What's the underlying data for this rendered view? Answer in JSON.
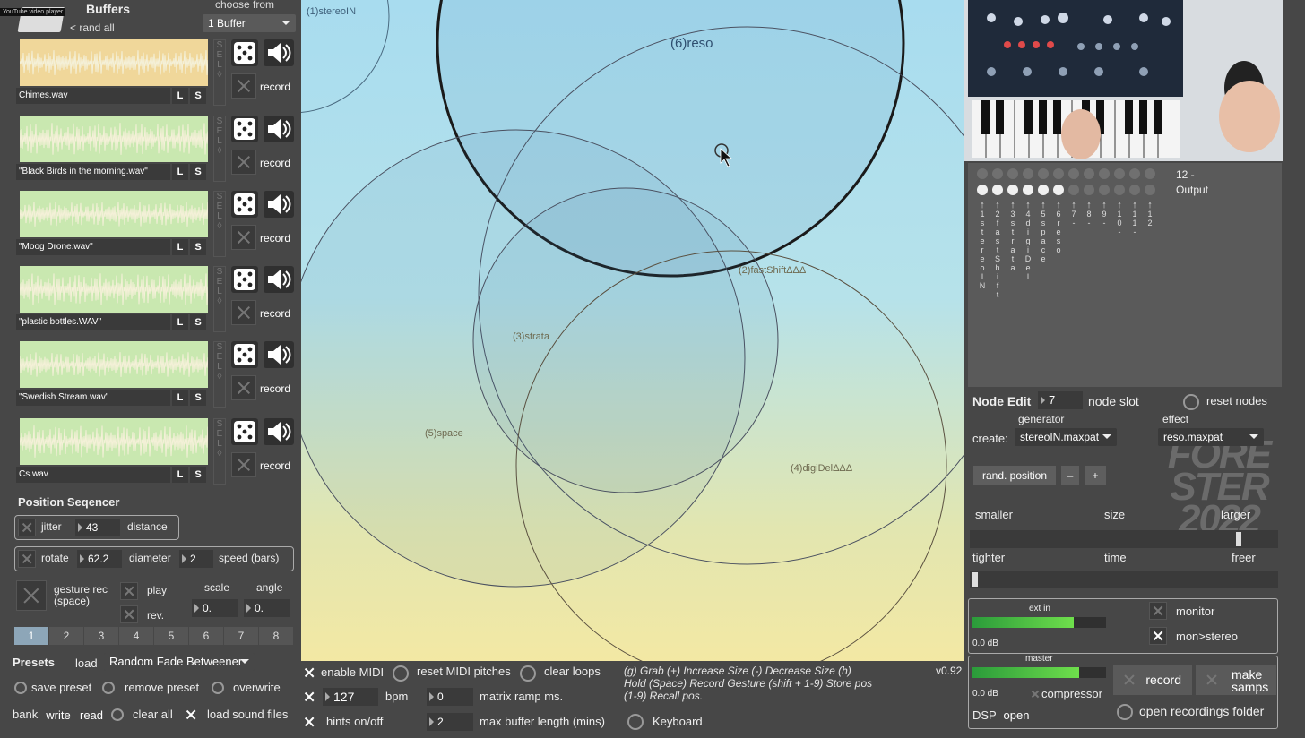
{
  "overlay": {
    "yt_label": "YouTube video player"
  },
  "buffers": {
    "title": "Buffers",
    "rand_all": "< rand all",
    "choose_from": "choose from",
    "choose_value": "1 Buffer",
    "items": [
      {
        "file": "Chimes.wav",
        "wave": "#f0d79a"
      },
      {
        "file": "\"Black Birds in the morning.wav\"",
        "wave": "#c9e8b0"
      },
      {
        "file": "\"Moog Drone.wav\"",
        "wave": "#c9e8b0"
      },
      {
        "file": "\"plastic bottles.WAV\"",
        "wave": "#c9e8b0"
      },
      {
        "file": "\"Swedish Stream.wav\"",
        "wave": "#c9e8b0"
      },
      {
        "file": "Cs.wav",
        "wave": "#c9e8b0"
      }
    ],
    "l": "L",
    "s": "S",
    "record": "record",
    "sel": "SEL"
  },
  "seq": {
    "title": "Position Seqencer",
    "jitter": "jitter",
    "jitter_val": "43",
    "distance": "distance",
    "rotate": "rotate",
    "rotate_val": "62.2",
    "diameter": "diameter",
    "diameter_val": "2",
    "speed": "speed (bars)",
    "gesture": "gesture rec",
    "space": "(space)",
    "play": "play",
    "rev": "rev.",
    "scale": "scale",
    "angle": "angle",
    "scale_val": "0.",
    "angle_val": "0.",
    "steps": [
      "1",
      "2",
      "3",
      "4",
      "5",
      "6",
      "7",
      "8"
    ]
  },
  "presets": {
    "title": "Presets",
    "load": "load",
    "load_value": "Random Fade Betweener",
    "save": "save preset",
    "remove": "remove preset",
    "overwrite": "overwrite",
    "bank": "bank",
    "write": "write",
    "read": "read",
    "clear_all": "clear all",
    "load_sound": "load sound files"
  },
  "canvas": {
    "nodes": [
      "(1)stereoIN",
      "(6)reso",
      "(2)fastShiftΔΔΔ",
      "(3)strata",
      "(5)space",
      "(4)digiDelΔΔΔ"
    ]
  },
  "bottom": {
    "enable_midi": "enable MIDI",
    "reset_midi": "reset MIDI pitches",
    "clear_loops": "clear loops",
    "bpm_val": "127",
    "bpm": "bpm",
    "ramp_val": "0",
    "ramp": "matrix ramp ms.",
    "hints": "hints on/off",
    "maxbuf_val": "2",
    "maxbuf": "max buffer length (mins)",
    "keyboard": "Keyboard",
    "help1": "(g) Grab    (+) Increase Size    (-) Decrease Size    (h)",
    "help2": "Hold   (Space) Record Gesture   (shift + 1-9) Store pos",
    "help3": "(1-9) Recall pos.",
    "version": "v0.92"
  },
  "matrix": {
    "out1": "12 -",
    "out2": "Output",
    "channels": [
      "1 stereoIN",
      "2 fastShift",
      "3 strata",
      "4 digiDel",
      "5 space",
      "6 reso",
      "7 -",
      "8 -",
      "9 -",
      "10 -",
      "11 -",
      "12"
    ],
    "logo": "FORE STER 2022"
  },
  "node_edit": {
    "title": "Node Edit",
    "slot_val": "7",
    "slot": "node slot",
    "reset": "reset nodes",
    "generator": "generator",
    "effect": "effect",
    "create": "create:",
    "gen_value": "stereoIN.maxpat",
    "fx_value": "reso.maxpat",
    "rand_pos": "rand. position",
    "minus": "–",
    "plus": "+",
    "smaller": "smaller",
    "size": "size",
    "larger": "larger",
    "size_level": 0.88,
    "tighter": "tighter",
    "time": "time",
    "freer": "freer",
    "time_level": 0.01
  },
  "audio": {
    "ext_in": "ext in",
    "ext_db": "0.0 dB",
    "ext_level": 0.76,
    "monitor": "monitor",
    "mon_stereo": "mon>stereo",
    "master": "master",
    "master_db": "0.0 dB",
    "master_level": 0.8,
    "compressor": "compressor",
    "record": "record",
    "make": "make",
    "samps": "samps",
    "dsp": "DSP",
    "open": "open",
    "open_folder": "open recordings folder"
  }
}
